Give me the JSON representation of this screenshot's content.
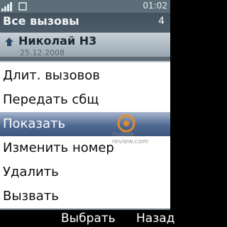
{
  "status": {
    "time": "01:02"
  },
  "app": {
    "title": "Все вызовы",
    "count": "4",
    "list_item_name": "Николай Н3",
    "list_item_subtext": "25.12.2008"
  },
  "menu": {
    "items": [
      {
        "label": "Длит. вызовов",
        "selected": false
      },
      {
        "label": "Передать сбщ",
        "selected": false
      },
      {
        "label": "Показать",
        "selected": true
      },
      {
        "label": "Изменить номер",
        "selected": false
      },
      {
        "label": "Удалить",
        "selected": false
      },
      {
        "label": "Вызвать",
        "selected": false
      }
    ]
  },
  "watermark": {
    "text": "mobile-review.com"
  },
  "softkeys": {
    "left": "Выбрать",
    "right": "Назад"
  },
  "colors": {
    "highlight": "#4f6a93",
    "menu_bg": "#ffffff",
    "softkey_bar": "#000000",
    "watermark_accent": "#f28c1c"
  },
  "icons": {
    "signal": "signal-strength-icon",
    "sim": "sim-indicator-icon",
    "contact": "contact-icon",
    "watermark": "mobile-review-logo-icon"
  }
}
